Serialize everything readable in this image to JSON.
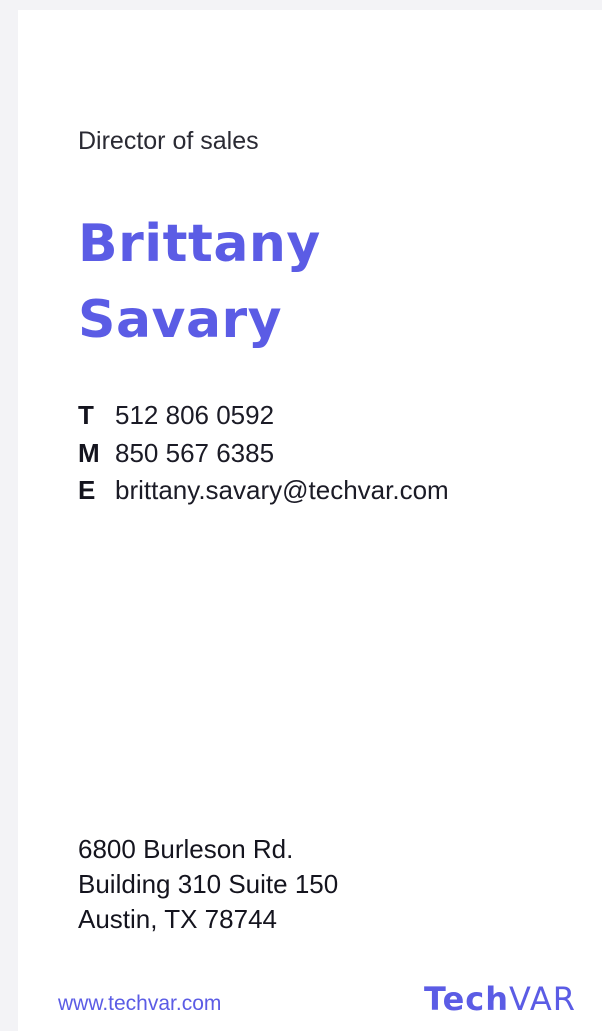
{
  "card": {
    "job_title": "Director of sales",
    "name_first": "Brittany",
    "name_last": "Savary",
    "contacts": [
      {
        "key": "T",
        "value": "512 806 0592"
      },
      {
        "key": "M",
        "value": "850 567 6385"
      },
      {
        "key": "E",
        "value": "brittany.savary@techvar.com"
      }
    ],
    "address": [
      "6800 Burleson Rd.",
      "Building 310 Suite 150",
      "Austin, TX 78744"
    ],
    "website": "www.techvar.com",
    "logo": {
      "part1": "Tech",
      "part2": "VAR"
    }
  },
  "colors": {
    "accent": "#5b5ce5",
    "text": "#14141e",
    "background": "#ffffff"
  }
}
